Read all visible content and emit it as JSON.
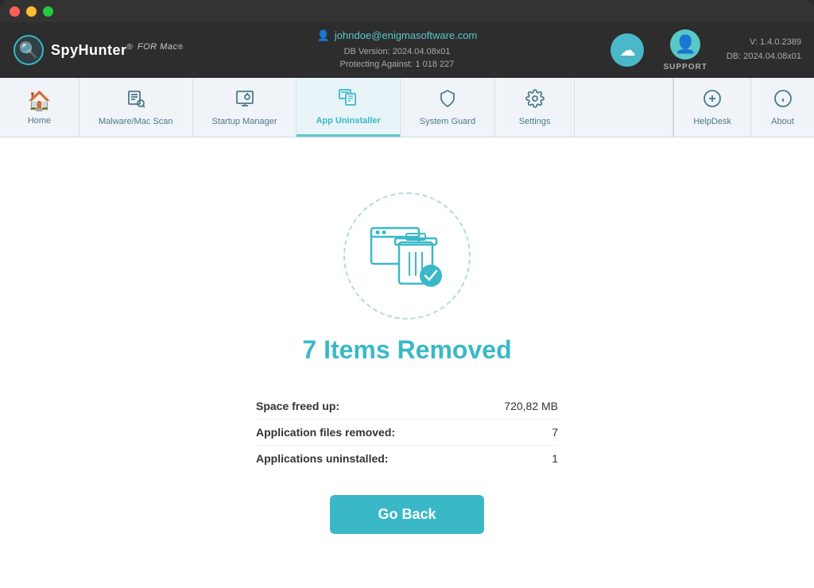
{
  "window": {
    "traffic_lights": [
      "red",
      "yellow",
      "green"
    ]
  },
  "header": {
    "logo_name": "SpyHunter",
    "logo_registered": "®",
    "logo_for": "FOR Mac",
    "logo_trademark": "®",
    "user_email": "johndoe@enigmasoftware.com",
    "db_version_label": "DB Version:",
    "db_version": "2024.04.08x01",
    "protecting_label": "Protecting Against:",
    "protecting_count": "1 018 227",
    "support_label": "SUPPORT",
    "version_v": "V: 1.4.0.2389",
    "version_db": "DB:  2024.04.08x01"
  },
  "nav": {
    "items": [
      {
        "id": "home",
        "label": "Home",
        "icon": "🏠"
      },
      {
        "id": "malware-scan",
        "label": "Malware/Mac Scan",
        "icon": "🔍"
      },
      {
        "id": "startup-manager",
        "label": "Startup Manager",
        "icon": "⚙"
      },
      {
        "id": "app-uninstaller",
        "label": "App Uninstaller",
        "icon": "🗑"
      },
      {
        "id": "system-guard",
        "label": "System Guard",
        "icon": "🛡"
      },
      {
        "id": "settings",
        "label": "Settings",
        "icon": "⚙"
      }
    ],
    "right_items": [
      {
        "id": "helpdesk",
        "label": "HelpDesk",
        "icon": "➕"
      },
      {
        "id": "about",
        "label": "About",
        "icon": "ℹ"
      }
    ]
  },
  "main": {
    "title": "7 Items Removed",
    "stats": [
      {
        "label": "Space freed up:",
        "value": "720,82 MB"
      },
      {
        "label": "Application files removed:",
        "value": "7"
      },
      {
        "label": "Applications uninstalled:",
        "value": "1"
      }
    ],
    "go_back_label": "Go Back"
  },
  "colors": {
    "accent": "#3ab8c8",
    "accent_dark": "#2ea8b8",
    "nav_bg": "#f0f4f8",
    "active_nav": "#e8f4f8"
  }
}
